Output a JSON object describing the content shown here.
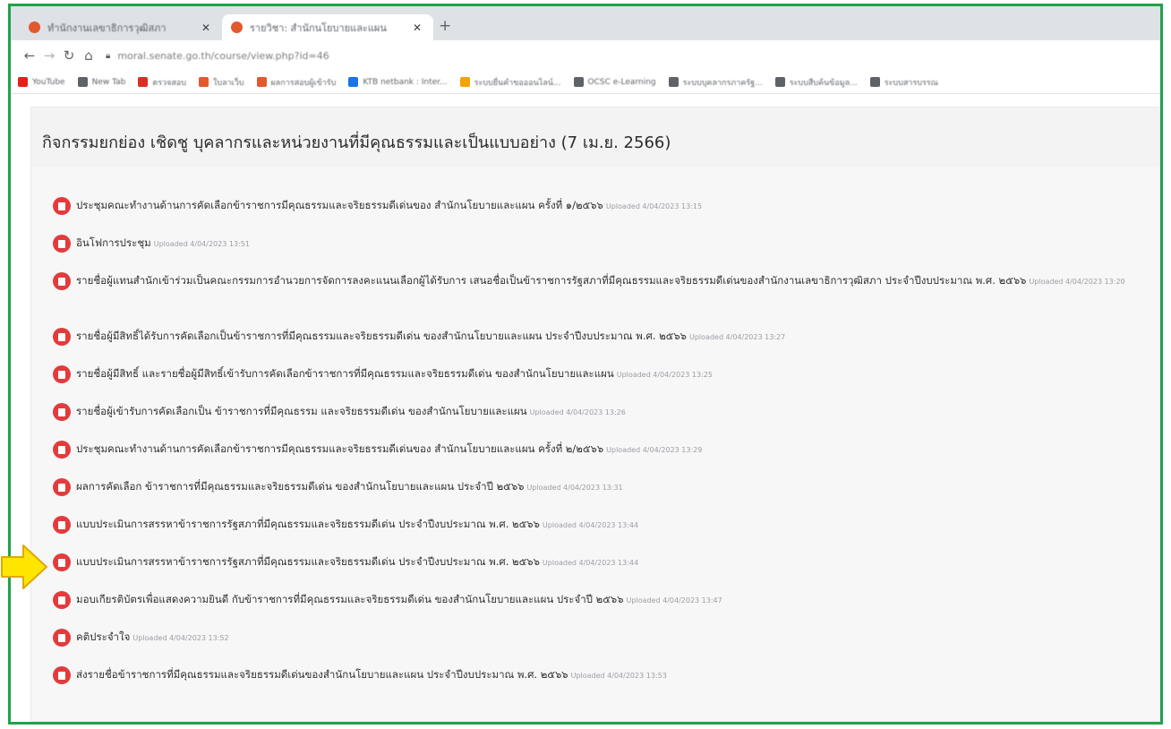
{
  "tabs": [
    {
      "title": "ทำนักงานเลขาธิการวุฒิสภา"
    },
    {
      "title": "รายวิชา: สำนักนโยบายและแผน"
    }
  ],
  "toolbar": {
    "url": "moral.senate.go.th/course/view.php?id=46"
  },
  "bookmarks": [
    {
      "label": "YouTube",
      "color": "#e62117"
    },
    {
      "label": "New Tab",
      "color": "#5f6368"
    },
    {
      "label": "ตรวจสอบ",
      "color": "#d93025"
    },
    {
      "label": "ใบลาเว็บ",
      "color": "#e2592d"
    },
    {
      "label": "ผลการสอบผู้เข้ารับ",
      "color": "#e2592d"
    },
    {
      "label": "KTB netbank : Inter...",
      "color": "#1a73e8"
    },
    {
      "label": "ระบบยื่นคำขอออนไลน์...",
      "color": "#f4a400"
    },
    {
      "label": "OCSC e-Learning",
      "color": "#5f6368"
    },
    {
      "label": "ระบบบุคลากรภาครัฐ...",
      "color": "#5f6368"
    },
    {
      "label": "ระบบสืบค้นข้อมูล...",
      "color": "#5f6368"
    },
    {
      "label": "ระบบสารบรรณ",
      "color": "#5f6368"
    }
  ],
  "course": {
    "title": "กิจกรรมยกย่อง เชิดชู บุคลากรและหน่วยงานที่มีคุณธรรมและเป็นแบบอย่าง (7 เม.ย. 2566)"
  },
  "items": [
    {
      "text": "ประชุมคณะทำงานด้านการคัดเลือกข้าราชการมีคุณธรรมและจริยธรรมดีเด่นของ สำนักนโยบายและแผน ครั้งที่ ๑/๒๕๖๖",
      "uploaded": "Uploaded 4/04/2023 13:15"
    },
    {
      "text": "อินโฟการประชุม",
      "uploaded": "Uploaded 4/04/2023 13:51"
    },
    {
      "text": "รายชื่อผู้แทนสำนักเข้าร่วมเป็นคณะกรรมการอำนวยการจัดการลงคะแนนเลือกผู้ได้รับการ เสนอชื่อเป็นข้าราชการรัฐสภาที่มีคุณธรรมและจริยธรรมดีเด่นของสำนักงานเลขาธิการวุฒิสภา ประจำปีงบประมาณ พ.ศ. ๒๕๖๖",
      "uploaded": "Uploaded 4/04/2023 13:20"
    },
    {
      "text": "รายชื่อผู้มีสิทธิ์ได้รับการคัดเลือกเป็นข้าราชการที่มีคุณธรรมและจริยธรรมดีเด่น ของสำนักนโยบายและแผน ประจำปีงบประมาณ พ.ศ. ๒๕๖๖",
      "uploaded": "Uploaded 4/04/2023 13:27"
    },
    {
      "text": "รายชื่อผู้มีสิทธิ์ และรายชื่อผู้มีสิทธิ์เข้ารับการคัดเลือกข้าราชการที่มีคุณธรรมและจริยธรรมดีเด่น ของสำนักนโยบายและแผน",
      "uploaded": "Uploaded 4/04/2023 13:25"
    },
    {
      "text": "รายชื่อผู้เข้ารับการคัดเลือกเป็น ข้าราชการที่มีคุณธรรม และจริยธรรมดีเด่น ของสำนักนโยบายและแผน",
      "uploaded": "Uploaded 4/04/2023 13:26"
    },
    {
      "text": "ประชุมคณะทำงานด้านการคัดเลือกข้าราชการมีคุณธรรมและจริยธรรมดีเด่นของ สำนักนโยบายและแผน ครั้งที่ ๒/๒๕๖๖",
      "uploaded": "Uploaded 4/04/2023 13:29"
    },
    {
      "text": "ผลการคัดเลือก ข้าราชการที่มีคุณธรรมและจริยธรรมดีเด่น ของสำนักนโยบายและแผน ประจำปี ๒๕๖๖",
      "uploaded": "Uploaded 4/04/2023 13:31"
    },
    {
      "text": "แบบประเมินการสรรหาข้าราชการรัฐสภาที่มีคุณธรรมและจริยธรรมดีเด่น ประจำปีงบประมาณ พ.ศ. ๒๕๖๖",
      "uploaded": "Uploaded 4/04/2023 13:44"
    },
    {
      "text": "แบบประเมินการสรรหาข้าราชการรัฐสภาที่มีคุณธรรมและจริยธรรมดีเด่น ประจำปีงบประมาณ พ.ศ. ๒๕๖๖",
      "uploaded": "Uploaded 4/04/2023 13:44"
    },
    {
      "text": "มอบเกียรติบัตรเพื่อแสดงความยินดี กับข้าราชการที่มีคุณธรรมและจริยธรรมดีเด่น ของสำนักนโยบายและแผน ประจำปี ๒๕๖๖",
      "uploaded": "Uploaded 4/04/2023 13:47"
    },
    {
      "text": "คติประจำใจ",
      "uploaded": "Uploaded 4/04/2023 13:52"
    },
    {
      "text": "ส่งรายชื่อข้าราชการที่มีคุณธรรมและจริยธรรมดีเด่นของสำนักนโยบายและแผน ประจำปีงบประมาณ พ.ศ. ๒๕๖๖",
      "uploaded": "Uploaded 4/04/2023 13:53"
    }
  ],
  "colors": {
    "frame_border": "#1ea34a",
    "pdf_icon": "#e33b3b",
    "arrow_fill": "#ffe600",
    "arrow_stroke": "#e0a800"
  }
}
